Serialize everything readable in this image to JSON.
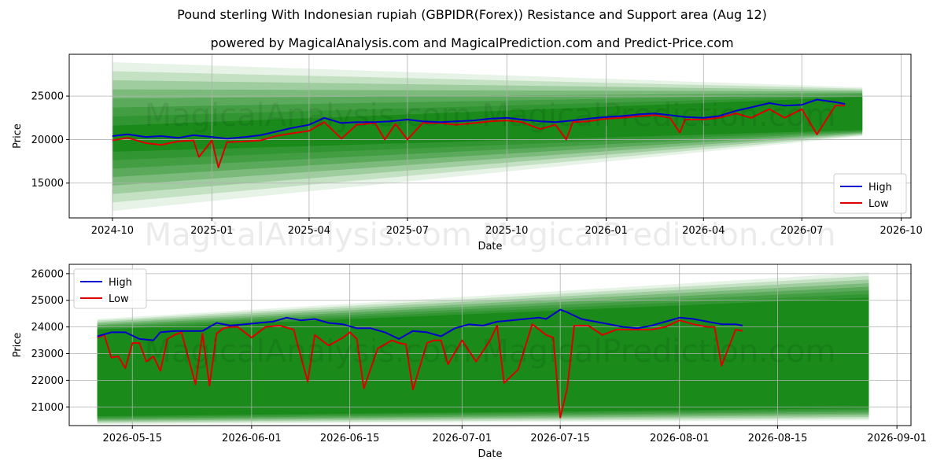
{
  "title": "Pound sterling With Indonesian rupiah (GBPIDR(Forex)) Resistance and Support area (Aug 12)",
  "subtitle": "powered by MagicalAnalysis.com and MagicalPrediction.com and Predict-Price.com",
  "watermark": "MagicalAnalysis.com    MagicalPrediction.com",
  "colors": {
    "high": "#0000cc",
    "low": "#dd0000",
    "band": "#1a8a1a",
    "light_band": "#b9dcb9",
    "grid": "#b0b0b0"
  },
  "chart_data": [
    {
      "type": "line",
      "xlabel": "Date",
      "ylabel": "Price",
      "x_ticks": [
        "2024-10",
        "2025-01",
        "2025-04",
        "2025-07",
        "2025-10",
        "2026-01",
        "2026-04",
        "2026-07",
        "2026-10"
      ],
      "y_ticks": [
        "15000",
        "20000",
        "25000"
      ],
      "xlim": [
        "2024-08-22",
        "2026-10-10"
      ],
      "ylim": [
        11000,
        29800
      ],
      "grid": true,
      "legend": {
        "position": "lower-right",
        "entries": [
          "High",
          "Low"
        ]
      },
      "bands": {
        "x": [
          "2024-10-01",
          "2026-08-26"
        ],
        "outer_light": {
          "upper": [
            28900,
            26000
          ],
          "lower": [
            11800,
            20400
          ]
        },
        "dark": {
          "upper": [
            21600,
            24900
          ],
          "lower": [
            18600,
            21100
          ]
        }
      },
      "series": [
        {
          "name": "High",
          "x": [
            "2024-10-01",
            "2024-10-15",
            "2024-11-01",
            "2024-11-15",
            "2024-12-01",
            "2024-12-15",
            "2025-01-01",
            "2025-01-15",
            "2025-02-01",
            "2025-02-15",
            "2025-03-01",
            "2025-03-15",
            "2025-04-01",
            "2025-04-15",
            "2025-05-01",
            "2025-05-15",
            "2025-06-01",
            "2025-06-15",
            "2025-07-01",
            "2025-07-15",
            "2025-08-01",
            "2025-08-15",
            "2025-09-01",
            "2025-09-15",
            "2025-10-01",
            "2025-10-15",
            "2025-11-01",
            "2025-11-15",
            "2025-12-01",
            "2025-12-15",
            "2026-01-01",
            "2026-01-15",
            "2026-02-01",
            "2026-02-15",
            "2026-03-01",
            "2026-03-15",
            "2026-04-01",
            "2026-04-15",
            "2026-05-01",
            "2026-05-15",
            "2026-06-01",
            "2026-06-15",
            "2026-07-01",
            "2026-07-15",
            "2026-08-01",
            "2026-08-10"
          ],
          "values": [
            20400,
            20600,
            20300,
            20400,
            20200,
            20500,
            20300,
            20100,
            20300,
            20500,
            20900,
            21300,
            21700,
            22500,
            21900,
            22000,
            22000,
            22100,
            22300,
            22100,
            22000,
            22100,
            22200,
            22400,
            22500,
            22300,
            22100,
            22000,
            22200,
            22400,
            22600,
            22700,
            22900,
            23000,
            22800,
            22600,
            22500,
            22700,
            23300,
            23700,
            24200,
            23900,
            24000,
            24600,
            24300,
            24100
          ]
        },
        {
          "name": "Low",
          "x": [
            "2024-10-01",
            "2024-10-15",
            "2024-11-01",
            "2024-11-15",
            "2024-12-01",
            "2024-12-15",
            "2024-12-20",
            "2025-01-01",
            "2025-01-07",
            "2025-01-15",
            "2025-02-01",
            "2025-02-15",
            "2025-03-01",
            "2025-03-15",
            "2025-04-01",
            "2025-04-15",
            "2025-05-01",
            "2025-05-15",
            "2025-06-01",
            "2025-06-10",
            "2025-06-20",
            "2025-07-01",
            "2025-07-15",
            "2025-08-01",
            "2025-08-15",
            "2025-09-01",
            "2025-09-15",
            "2025-10-01",
            "2025-10-15",
            "2025-11-01",
            "2025-11-15",
            "2025-11-25",
            "2025-12-01",
            "2025-12-15",
            "2026-01-01",
            "2026-01-15",
            "2026-02-01",
            "2026-02-15",
            "2026-03-01",
            "2026-03-10",
            "2026-03-15",
            "2026-04-01",
            "2026-04-15",
            "2026-05-01",
            "2026-05-15",
            "2026-06-01",
            "2026-06-15",
            "2026-07-01",
            "2026-07-15",
            "2026-08-01",
            "2026-08-10"
          ],
          "values": [
            19900,
            20200,
            19600,
            19400,
            19800,
            19900,
            18000,
            19900,
            16800,
            19700,
            19800,
            19900,
            20400,
            20700,
            21000,
            22000,
            20100,
            21700,
            21900,
            20000,
            21800,
            20000,
            21900,
            21900,
            21700,
            21900,
            22100,
            22200,
            22000,
            21200,
            21700,
            20000,
            22000,
            22100,
            22400,
            22500,
            22700,
            22800,
            22500,
            20800,
            22300,
            22300,
            22500,
            23000,
            22500,
            23500,
            22500,
            23500,
            20600,
            23900,
            23900
          ]
        }
      ]
    },
    {
      "type": "line",
      "xlabel": "Date",
      "ylabel": "Price",
      "x_ticks": [
        "2026-05-15",
        "2026-06-01",
        "2026-06-15",
        "2026-07-01",
        "2026-07-15",
        "2026-08-01",
        "2026-08-15",
        "2026-09-01"
      ],
      "y_ticks": [
        "21000",
        "22000",
        "23000",
        "24000",
        "25000",
        "26000"
      ],
      "xlim": [
        "2026-05-06",
        "2026-09-03"
      ],
      "ylim": [
        20300,
        26350
      ],
      "grid": true,
      "legend": {
        "position": "top-left",
        "entries": [
          "High",
          "Low"
        ]
      },
      "bands": {
        "x": [
          "2026-05-10",
          "2026-08-28"
        ],
        "outer_light": {
          "upper": [
            24300,
            26050
          ],
          "lower": [
            20350,
            20500
          ]
        },
        "dark": {
          "upper": [
            23900,
            25100
          ],
          "lower": [
            20650,
            20950
          ]
        }
      },
      "series": [
        {
          "name": "High",
          "x": [
            "2026-05-10",
            "2026-05-12",
            "2026-05-14",
            "2026-05-16",
            "2026-05-18",
            "2026-05-19",
            "2026-05-21",
            "2026-05-23",
            "2026-05-25",
            "2026-05-27",
            "2026-05-29",
            "2026-05-31",
            "2026-06-02",
            "2026-06-04",
            "2026-06-06",
            "2026-06-08",
            "2026-06-10",
            "2026-06-12",
            "2026-06-14",
            "2026-06-16",
            "2026-06-18",
            "2026-06-20",
            "2026-06-22",
            "2026-06-24",
            "2026-06-26",
            "2026-06-28",
            "2026-06-30",
            "2026-07-02",
            "2026-07-04",
            "2026-07-06",
            "2026-07-08",
            "2026-07-10",
            "2026-07-12",
            "2026-07-13",
            "2026-07-15",
            "2026-07-16",
            "2026-07-18",
            "2026-07-20",
            "2026-07-22",
            "2026-07-24",
            "2026-07-26",
            "2026-07-28",
            "2026-07-30",
            "2026-08-01",
            "2026-08-03",
            "2026-08-05",
            "2026-08-07",
            "2026-08-09",
            "2026-08-10"
          ],
          "values": [
            23650,
            23800,
            23800,
            23550,
            23500,
            23800,
            23850,
            23850,
            23850,
            24150,
            24050,
            24100,
            24150,
            24200,
            24350,
            24250,
            24300,
            24150,
            24100,
            23950,
            23950,
            23800,
            23550,
            23850,
            23800,
            23650,
            23950,
            24100,
            24050,
            24200,
            24250,
            24300,
            24350,
            24300,
            24650,
            24550,
            24300,
            24200,
            24100,
            24000,
            23950,
            24050,
            24200,
            24350,
            24300,
            24200,
            24100,
            24100,
            24050
          ]
        },
        {
          "name": "Low",
          "x": [
            "2026-05-10",
            "2026-05-11",
            "2026-05-12",
            "2026-05-13",
            "2026-05-14",
            "2026-05-15",
            "2026-05-16",
            "2026-05-17",
            "2026-05-18",
            "2026-05-19",
            "2026-05-20",
            "2026-05-21",
            "2026-05-22",
            "2026-05-24",
            "2026-05-25",
            "2026-05-26",
            "2026-05-27",
            "2026-05-28",
            "2026-05-29",
            "2026-05-30",
            "2026-06-01",
            "2026-06-03",
            "2026-06-05",
            "2026-06-07",
            "2026-06-08",
            "2026-06-09",
            "2026-06-10",
            "2026-06-12",
            "2026-06-14",
            "2026-06-15",
            "2026-06-16",
            "2026-06-17",
            "2026-06-19",
            "2026-06-21",
            "2026-06-22",
            "2026-06-23",
            "2026-06-24",
            "2026-06-26",
            "2026-06-27",
            "2026-06-28",
            "2026-06-29",
            "2026-07-01",
            "2026-07-03",
            "2026-07-05",
            "2026-07-06",
            "2026-07-07",
            "2026-07-09",
            "2026-07-11",
            "2026-07-13",
            "2026-07-14",
            "2026-07-15",
            "2026-07-16",
            "2026-07-17",
            "2026-07-19",
            "2026-07-21",
            "2026-07-23",
            "2026-07-26",
            "2026-07-28",
            "2026-07-30",
            "2026-08-01",
            "2026-08-03",
            "2026-08-05",
            "2026-08-06",
            "2026-08-07",
            "2026-08-09",
            "2026-08-10"
          ],
          "values": [
            23600,
            23700,
            22850,
            22900,
            22450,
            23400,
            23400,
            22700,
            22900,
            22350,
            23550,
            23700,
            23800,
            21850,
            23750,
            21800,
            23750,
            23950,
            24000,
            24000,
            23600,
            24000,
            24050,
            23900,
            22900,
            21950,
            23700,
            23300,
            23600,
            23800,
            23550,
            21700,
            23200,
            23500,
            23400,
            23350,
            21650,
            23400,
            23500,
            23500,
            22600,
            23500,
            22700,
            23500,
            24050,
            21900,
            22400,
            24100,
            23700,
            23600,
            20600,
            21700,
            24050,
            24050,
            23700,
            23900,
            23900,
            23900,
            24000,
            24250,
            24100,
            24000,
            24000,
            22550,
            23900,
            23850
          ]
        }
      ]
    }
  ]
}
